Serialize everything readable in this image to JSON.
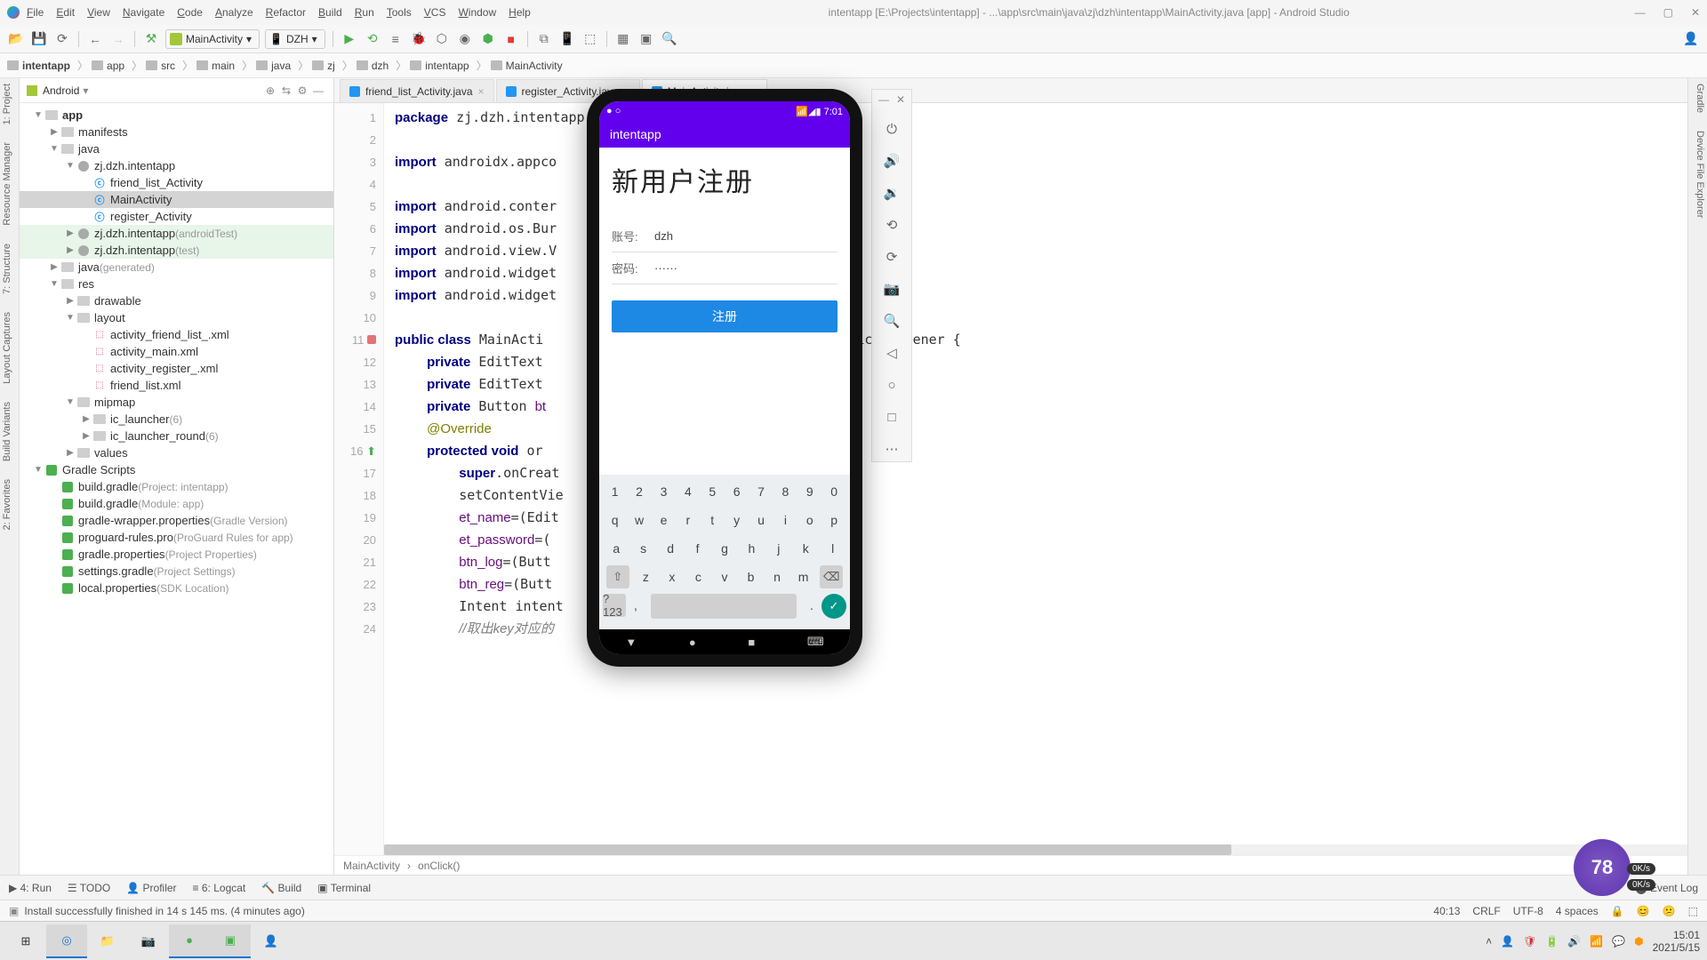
{
  "titlebar": {
    "menus": [
      "File",
      "Edit",
      "View",
      "Navigate",
      "Code",
      "Analyze",
      "Refactor",
      "Build",
      "Run",
      "Tools",
      "VCS",
      "Window",
      "Help"
    ],
    "title": "intentapp [E:\\Projects\\intentapp] - ...\\app\\src\\main\\java\\zj\\dzh\\intentapp\\MainActivity.java [app] - Android Studio"
  },
  "run_configs": {
    "app": "MainActivity",
    "device": "DZH"
  },
  "breadcrumbs": [
    "intentapp",
    "app",
    "src",
    "main",
    "java",
    "zj",
    "dzh",
    "intentapp",
    "MainActivity"
  ],
  "project": {
    "view": "Android",
    "tree": [
      {
        "d": 0,
        "arrow": "▼",
        "icon": "folder",
        "label": "app",
        "bold": true
      },
      {
        "d": 1,
        "arrow": "▶",
        "icon": "folder",
        "label": "manifests"
      },
      {
        "d": 1,
        "arrow": "▼",
        "icon": "folder",
        "label": "java"
      },
      {
        "d": 2,
        "arrow": "▼",
        "icon": "pkg",
        "label": "zj.dzh.intentapp"
      },
      {
        "d": 3,
        "arrow": "",
        "icon": "java",
        "label": "friend_list_Activity"
      },
      {
        "d": 3,
        "arrow": "",
        "icon": "java",
        "label": "MainActivity",
        "selected": true
      },
      {
        "d": 3,
        "arrow": "",
        "icon": "java",
        "label": "register_Activity"
      },
      {
        "d": 2,
        "arrow": "▶",
        "icon": "pkg",
        "label": "zj.dzh.intentapp",
        "hint": "(androidTest)",
        "cls": "androidTest"
      },
      {
        "d": 2,
        "arrow": "▶",
        "icon": "pkg",
        "label": "zj.dzh.intentapp",
        "hint": "(test)",
        "cls": "test"
      },
      {
        "d": 1,
        "arrow": "▶",
        "icon": "folder",
        "label": "java",
        "hint": "(generated)"
      },
      {
        "d": 1,
        "arrow": "▼",
        "icon": "folder",
        "label": "res"
      },
      {
        "d": 2,
        "arrow": "▶",
        "icon": "folder",
        "label": "drawable"
      },
      {
        "d": 2,
        "arrow": "▼",
        "icon": "folder",
        "label": "layout"
      },
      {
        "d": 3,
        "arrow": "",
        "icon": "xml",
        "label": "activity_friend_list_.xml"
      },
      {
        "d": 3,
        "arrow": "",
        "icon": "xml",
        "label": "activity_main.xml"
      },
      {
        "d": 3,
        "arrow": "",
        "icon": "xml",
        "label": "activity_register_.xml"
      },
      {
        "d": 3,
        "arrow": "",
        "icon": "xml",
        "label": "friend_list.xml"
      },
      {
        "d": 2,
        "arrow": "▼",
        "icon": "folder",
        "label": "mipmap"
      },
      {
        "d": 3,
        "arrow": "▶",
        "icon": "folder",
        "label": "ic_launcher",
        "hint": "(6)"
      },
      {
        "d": 3,
        "arrow": "▶",
        "icon": "folder",
        "label": "ic_launcher_round",
        "hint": "(6)"
      },
      {
        "d": 2,
        "arrow": "▶",
        "icon": "folder",
        "label": "values"
      },
      {
        "d": 0,
        "arrow": "▼",
        "icon": "gradle",
        "label": "Gradle Scripts"
      },
      {
        "d": 1,
        "arrow": "",
        "icon": "gradle",
        "label": "build.gradle",
        "hint": "(Project: intentapp)"
      },
      {
        "d": 1,
        "arrow": "",
        "icon": "gradle",
        "label": "build.gradle",
        "hint": "(Module: app)"
      },
      {
        "d": 1,
        "arrow": "",
        "icon": "gradle",
        "label": "gradle-wrapper.properties",
        "hint": "(Gradle Version)"
      },
      {
        "d": 1,
        "arrow": "",
        "icon": "gradle",
        "label": "proguard-rules.pro",
        "hint": "(ProGuard Rules for app)"
      },
      {
        "d": 1,
        "arrow": "",
        "icon": "gradle",
        "label": "gradle.properties",
        "hint": "(Project Properties)"
      },
      {
        "d": 1,
        "arrow": "",
        "icon": "gradle",
        "label": "settings.gradle",
        "hint": "(Project Settings)"
      },
      {
        "d": 1,
        "arrow": "",
        "icon": "gradle",
        "label": "local.properties",
        "hint": "(SDK Location)"
      }
    ]
  },
  "tabs": [
    {
      "label": "friend_list_Activity.java",
      "active": false
    },
    {
      "label": "register_Activity.java",
      "active": false
    },
    {
      "label": "MainActivity.java",
      "active": true
    }
  ],
  "code_lines_count": 24,
  "code_html": "<span class='kw'>package</span> zj.dzh.intentapp;\n\n<span class='kw'>import</span> androidx.appco\n\n<span class='kw'>import</span> android.conter\n<span class='kw'>import</span> android.os.Bur\n<span class='kw'>import</span> android.view.V\n<span class='kw'>import</span> android.widget\n<span class='kw'>import</span> android.widget\n\n<span class='kw'>public class</span> MainActi                         ents View.OnClickListener {\n    <span class='kw'>private</span> EditText\n    <span class='kw'>private</span> EditText\n    <span class='kw'>private</span> Button <span class='ident'>bt</span>\n    <span class='ann'>@Override</span>\n    <span class='kw'>protected void</span> or                                 {\n        <span class='kw'>super</span>.onCreat\n        setContentVie\n        <span class='ident'>et_name</span>=(Edit                            );\n        <span class='ident'>et_password</span>=(                         <span class='ident'>ssword</span>);\n        <span class='ident'>btn_log</span>=(Butt\n        <span class='ident'>btn_reg</span>=(Butt                         );\n        Intent intent\n        <span class='comment'>//取出key对应的</span>",
  "editor_crumbs": [
    "MainActivity",
    "onClick()"
  ],
  "left_strip": [
    "1: Project",
    "Resource Manager",
    "7: Structure",
    "Layout Captures",
    "Build Variants",
    "2: Favorites"
  ],
  "right_strip": [
    "Gradle",
    "Device File Explorer"
  ],
  "emulator": {
    "time": "7:01",
    "app_name": "intentapp",
    "page_title": "新用户注册",
    "fields": [
      {
        "label": "账号:",
        "value": "dzh"
      },
      {
        "label": "密码:",
        "value": "······"
      }
    ],
    "button": "注册",
    "keyboard": {
      "row1": [
        "1",
        "2",
        "3",
        "4",
        "5",
        "6",
        "7",
        "8",
        "9",
        "0"
      ],
      "row2": [
        "q",
        "w",
        "e",
        "r",
        "t",
        "y",
        "u",
        "i",
        "o",
        "p"
      ],
      "row3": [
        "a",
        "s",
        "d",
        "f",
        "g",
        "h",
        "j",
        "k",
        "l"
      ],
      "row4": [
        "z",
        "x",
        "c",
        "v",
        "b",
        "n",
        "m"
      ],
      "sym": "?123"
    }
  },
  "emulator_tools": [
    "⏻",
    "🔊",
    "🔉",
    "⟲",
    "⟳",
    "📷",
    "🔍",
    "◁",
    "○",
    "□",
    "⋯"
  ],
  "btm_tools": {
    "left": [
      "▶ 4: Run",
      "☰ TODO",
      "👤 Profiler",
      "≡ 6: Logcat",
      "🔨 Build",
      "▣ Terminal"
    ],
    "right": "Event Log"
  },
  "status": {
    "msg": "Install successfully finished in 14 s 145 ms. (4 minutes ago)",
    "pos": "40:13",
    "eol": "CRLF",
    "enc": "UTF-8",
    "indent": "4 spaces"
  },
  "taskbar": {
    "clock": "15:01",
    "date": "2021/5/15"
  },
  "badge": "78",
  "net": [
    "0K/s",
    "0K/s"
  ]
}
